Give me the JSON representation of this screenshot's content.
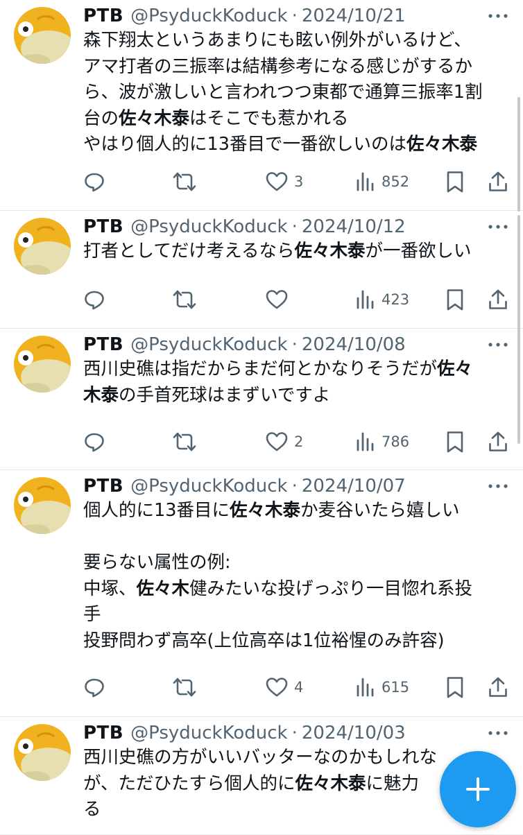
{
  "tweets": [
    {
      "name": "PTB",
      "handle": "@PsyduckKoduck",
      "date": "2024/10/21",
      "lines": [
        [
          {
            "t": "森下翔太というあまりにも眩い例外がいるけど、"
          }
        ],
        [
          {
            "t": "アマ打者の三振率は結構参考になる感じがするか"
          }
        ],
        [
          {
            "t": "ら、波が激しいと言われつつ東都で通算三振率1割"
          }
        ],
        [
          {
            "t": "台の"
          },
          {
            "t": "佐々木泰",
            "b": true
          },
          {
            "t": "はそこでも惹かれる"
          }
        ],
        [
          {
            "t": "やはり個人的に13番目で一番欲しいのは"
          },
          {
            "t": "佐々木泰",
            "b": true
          }
        ]
      ],
      "likes": "3",
      "views": "852"
    },
    {
      "name": "PTB",
      "handle": "@PsyduckKoduck",
      "date": "2024/10/12",
      "lines": [
        [
          {
            "t": "打者としてだけ考えるなら"
          },
          {
            "t": "佐々木泰",
            "b": true
          },
          {
            "t": "が一番欲しい"
          }
        ]
      ],
      "likes": "",
      "views": "423"
    },
    {
      "name": "PTB",
      "handle": "@PsyduckKoduck",
      "date": "2024/10/08",
      "lines": [
        [
          {
            "t": "西川史礁は指だからまだ何とかなりそうだが"
          },
          {
            "t": "佐々",
            "b": true
          }
        ],
        [
          {
            "t": "木泰",
            "b": true
          },
          {
            "t": "の手首死球はまずいですよ"
          }
        ]
      ],
      "likes": "2",
      "views": "786"
    },
    {
      "name": "PTB",
      "handle": "@PsyduckKoduck",
      "date": "2024/10/07",
      "lines": [
        [
          {
            "t": "個人的に13番目に"
          },
          {
            "t": "佐々木泰",
            "b": true
          },
          {
            "t": "か麦谷いたら嬉しい"
          }
        ],
        [
          {
            "t": ""
          }
        ],
        [
          {
            "t": "要らない属性の例:"
          }
        ],
        [
          {
            "t": "中塚、"
          },
          {
            "t": "佐々木",
            "b": true
          },
          {
            "t": "健みたいな投げっぷり一目惚れ系投"
          }
        ],
        [
          {
            "t": "手"
          }
        ],
        [
          {
            "t": "投野問わず高卒(上位高卒は1位裕惺のみ許容)"
          }
        ]
      ],
      "likes": "4",
      "views": "615"
    },
    {
      "name": "PTB",
      "handle": "@PsyduckKoduck",
      "date": "2024/10/03",
      "lines": [
        [
          {
            "t": "西川史礁の方がいいバッターなのかもしれな"
          }
        ],
        [
          {
            "t": "が、ただひたすら個人的に"
          },
          {
            "t": "佐々木泰",
            "b": true
          },
          {
            "t": "に魅力"
          }
        ],
        [
          {
            "t": "る"
          }
        ]
      ],
      "likes": "",
      "views": ""
    }
  ],
  "separator": "·",
  "icons": {
    "avatar": "psyduck-avatar",
    "reply": "reply-icon",
    "retweet": "retweet-icon",
    "like": "heart-icon",
    "views": "views-icon",
    "bookmark": "bookmark-icon",
    "share": "share-icon",
    "more": "more-icon",
    "compose": "plus-icon"
  },
  "colors": {
    "accent": "#1d9bf0",
    "muted": "#536471",
    "text": "#0f1419",
    "divider": "#e6e9ec",
    "avatar": "#f0b21e"
  }
}
